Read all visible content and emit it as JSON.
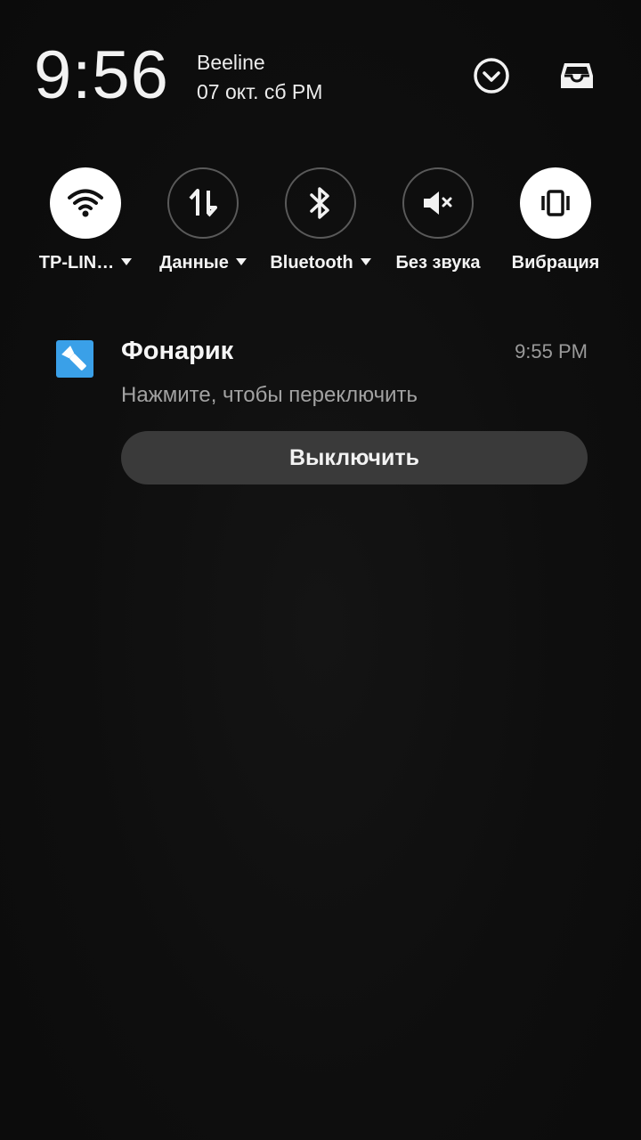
{
  "header": {
    "time": "9:56",
    "carrier": "Beeline",
    "date": "07 окт. сб PM",
    "expand_icon": "chevron-down-circle-icon",
    "inbox_icon": "inbox-tray-icon"
  },
  "quick_settings": [
    {
      "label": "TP-LIN…",
      "icon": "wifi-icon",
      "active": true,
      "has_menu": true
    },
    {
      "label": "Данные",
      "icon": "mobile-data-icon",
      "active": false,
      "has_menu": true
    },
    {
      "label": "Bluetooth",
      "icon": "bluetooth-icon",
      "active": false,
      "has_menu": true
    },
    {
      "label": "Без звука",
      "icon": "mute-icon",
      "active": false,
      "has_menu": false
    },
    {
      "label": "Вибрация",
      "icon": "vibrate-icon",
      "active": true,
      "has_menu": false
    }
  ],
  "notification": {
    "app_icon": "flashlight-icon",
    "title": "Фонарик",
    "time": "9:55 PM",
    "text": "Нажмите, чтобы переключить",
    "action_label": "Выключить"
  },
  "colors": {
    "background": "#0f0f0f",
    "tile_on": "#ffffff",
    "tile_off_border": "#5a5a5a",
    "action_button": "#3a3a3a",
    "app_icon_blue": "#3aa0e8"
  }
}
